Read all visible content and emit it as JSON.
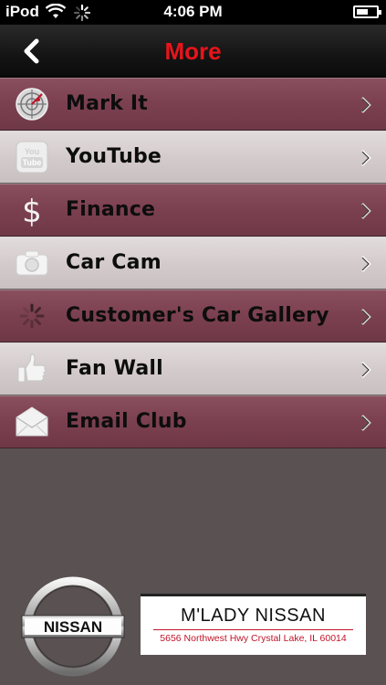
{
  "status_bar": {
    "carrier": "iPod",
    "time": "4:06 PM"
  },
  "nav": {
    "title": "More",
    "title_color": "#e8141b"
  },
  "menu": {
    "items": [
      {
        "label": "Mark It",
        "icon": "radar-icon",
        "style": "dark"
      },
      {
        "label": "YouTube",
        "icon": "youtube-icon",
        "style": "light"
      },
      {
        "label": "Finance",
        "icon": "dollar-icon",
        "style": "dark"
      },
      {
        "label": "Car Cam",
        "icon": "camera-icon",
        "style": "light"
      },
      {
        "label": "Customer's Car Gallery",
        "icon": "spinner-icon",
        "style": "dark"
      },
      {
        "label": "Fan Wall",
        "icon": "thumbs-up-icon",
        "style": "light"
      },
      {
        "label": "Email Club",
        "icon": "envelope-icon",
        "style": "dark"
      }
    ]
  },
  "footer": {
    "logo_text": "NISSAN",
    "dealer_name": "M'LADY NISSAN",
    "dealer_address": "5656 Northwest Hwy Crystal Lake, IL 60014"
  }
}
